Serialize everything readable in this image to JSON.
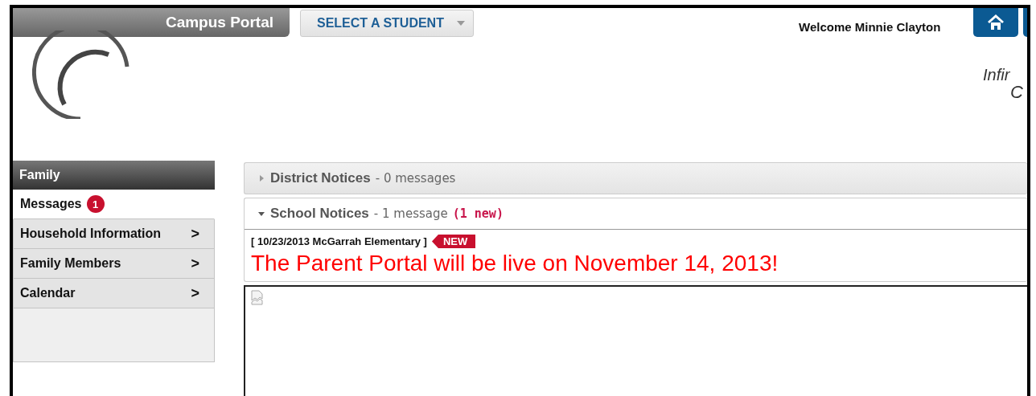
{
  "header": {
    "title": "Campus Portal",
    "student_select": {
      "label": "SELECT A STUDENT"
    },
    "welcome": "Welcome Minnie Clayton",
    "brand_lines": [
      "Infir",
      "C"
    ]
  },
  "sidebar": {
    "heading": "Family",
    "items": [
      {
        "label": "Messages",
        "badge": "1",
        "selected": true
      },
      {
        "label": "Household Information",
        "selected": false,
        "arrow": ">"
      },
      {
        "label": "Family Members",
        "selected": false,
        "arrow": ">"
      },
      {
        "label": "Calendar",
        "selected": false,
        "arrow": ">"
      }
    ]
  },
  "notices": [
    {
      "title": "District Notices",
      "count": "- 0 messages",
      "expanded": false
    },
    {
      "title": "School Notices",
      "count": "- 1 message",
      "new_count": "(1 new)",
      "expanded": true,
      "messages": [
        {
          "source": "[ 10/23/2013 McGarrah Elementary ]",
          "badge": "NEW",
          "text": "The Parent Portal will be live on November 14, 2013!"
        }
      ]
    }
  ]
}
